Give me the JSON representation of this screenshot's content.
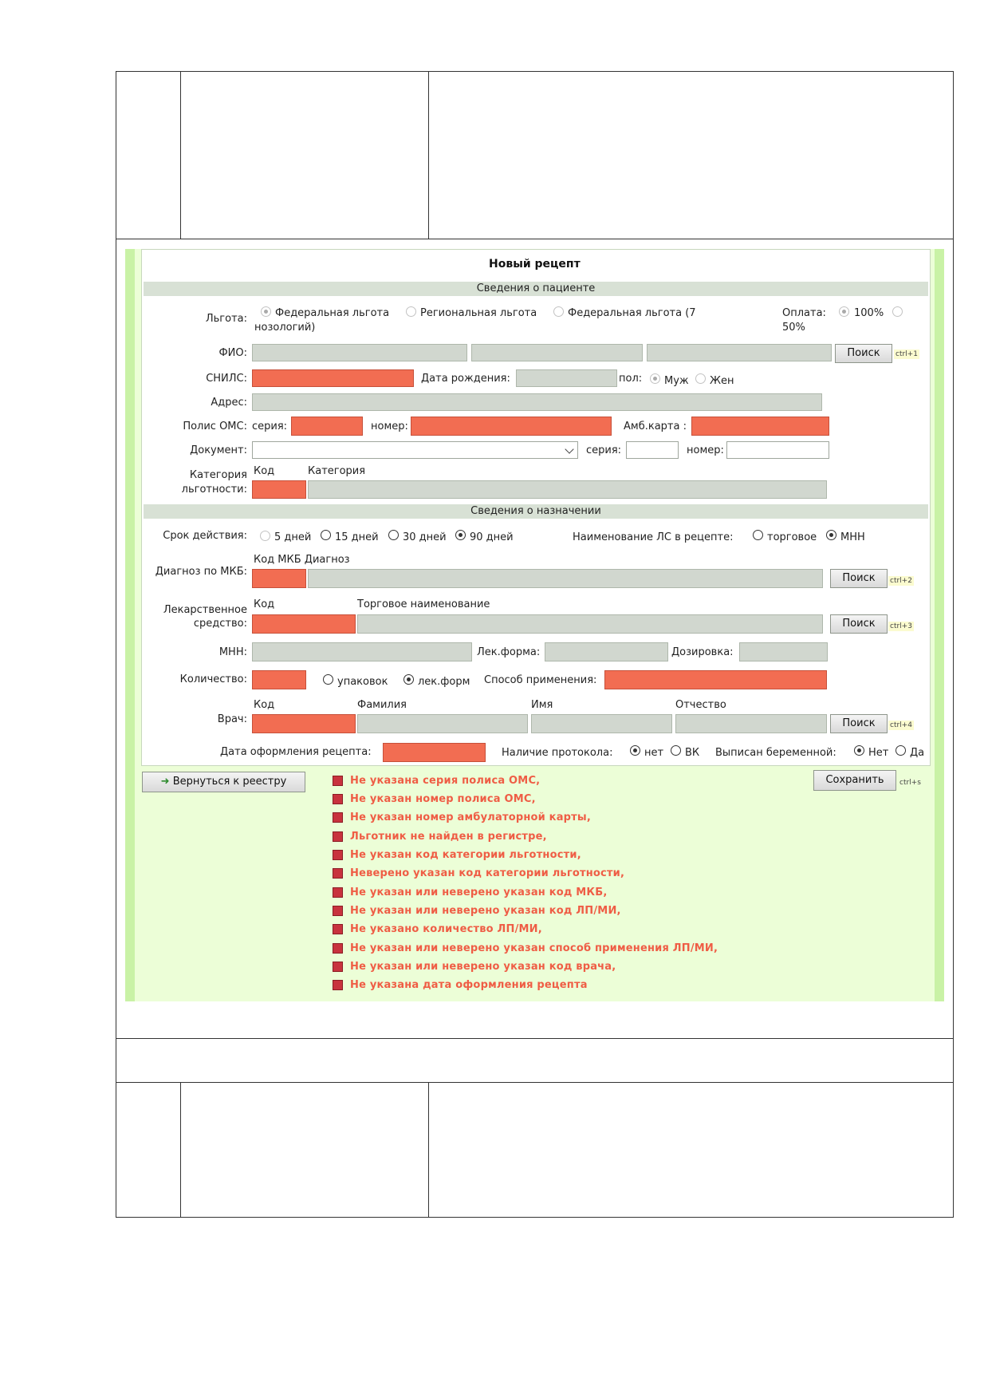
{
  "form": {
    "title": "Новый рецепт",
    "section_patient": "Сведения о пациенте",
    "section_prescription": "Сведения о назначении",
    "lgota_label": "Льгота:",
    "lgota_options": [
      "Федеральная льгота",
      "Региональная льгота",
      "Федеральная льгота (7",
      "нозологий)"
    ],
    "oplata_label": "Оплата:",
    "oplata_options": [
      "100%",
      "50%"
    ],
    "fio_label": "ФИО:",
    "search_label": "Поиск",
    "hint_1": "ctrl+1",
    "hint_2": "ctrl+2",
    "hint_3": "ctrl+3",
    "hint_4": "ctrl+4",
    "hint_s": "ctrl+s",
    "snils_label": "СНИЛС:",
    "birthdate_label": "Дата рождения:",
    "sex_label": "пол:",
    "sex_male": "Муж",
    "sex_female": "Жен",
    "address_label": "Адрес:",
    "polis_label": "Полис ОМС:",
    "series_label": "серия:",
    "number_label": "номер:",
    "amb_label": "Амб.карта :",
    "document_label": "Документ:",
    "doc_series_label": "серия:",
    "doc_number_label": "номер:",
    "category_label_1": "Категория",
    "category_label_2": "льготности:",
    "code_col": "Код",
    "category_col": "Категория",
    "validity_label": "Срок действия:",
    "validity_options": [
      "5 дней",
      "15 дней",
      "30 дней",
      "90 дней"
    ],
    "ls_name_label": "Наименование ЛС в рецепте:",
    "ls_name_options": [
      "торговое",
      "МНН"
    ],
    "diagnosis_label": "Диагноз по МКБ:",
    "mkb_cols": "Код МКБ Диагноз",
    "drug_label_1": "Лекарственное",
    "drug_label_2": "средство:",
    "trade_name_col": "Торговое наименование",
    "mnn_label": "МНН:",
    "lek_form_label": "Лек.форма:",
    "dosage_label": "Дозировка:",
    "quantity_label": "Количество:",
    "qty_options": [
      "упаковок",
      "лек.форм"
    ],
    "method_label": "Способ применения:",
    "doctor_label": "Врач:",
    "surname_col": "Фамилия",
    "name_col": "Имя",
    "patronymic_col": "Отчество",
    "issue_date_label": "Дата оформления рецепта:",
    "protocol_label": "Наличие протокола:",
    "protocol_options": [
      "нет",
      "ВК"
    ],
    "pregnant_label": "Выписан беременной:",
    "pregnant_options": [
      "Нет",
      "Да"
    ]
  },
  "actions": {
    "back_label": "Вернуться к реестру",
    "save_label": "Сохранить"
  },
  "errors": [
    "Не указана серия полиса ОМС,",
    "Не указан номер полиса ОМС,",
    "Не указан номер амбулаторной карты,",
    "Льготник не найден в регистре,",
    "Не указан код категории льготности,",
    "Неверено указан код категории льготности,",
    "Не указан или неверено указан код МКБ,",
    "Не указан или неверено указан код ЛП/МИ,",
    "Не указано количество ЛП/МИ,",
    "Не указан или неверено указан способ применения ЛП/МИ,",
    "Не указан или неверено указан код врача,",
    "Не указана дата оформления рецепта"
  ],
  "colors": {
    "invalid_field": "#f26d52",
    "panel_bg": "#ecfed7",
    "error_text": "#ef5d45",
    "error_marker": "#c8333e"
  }
}
